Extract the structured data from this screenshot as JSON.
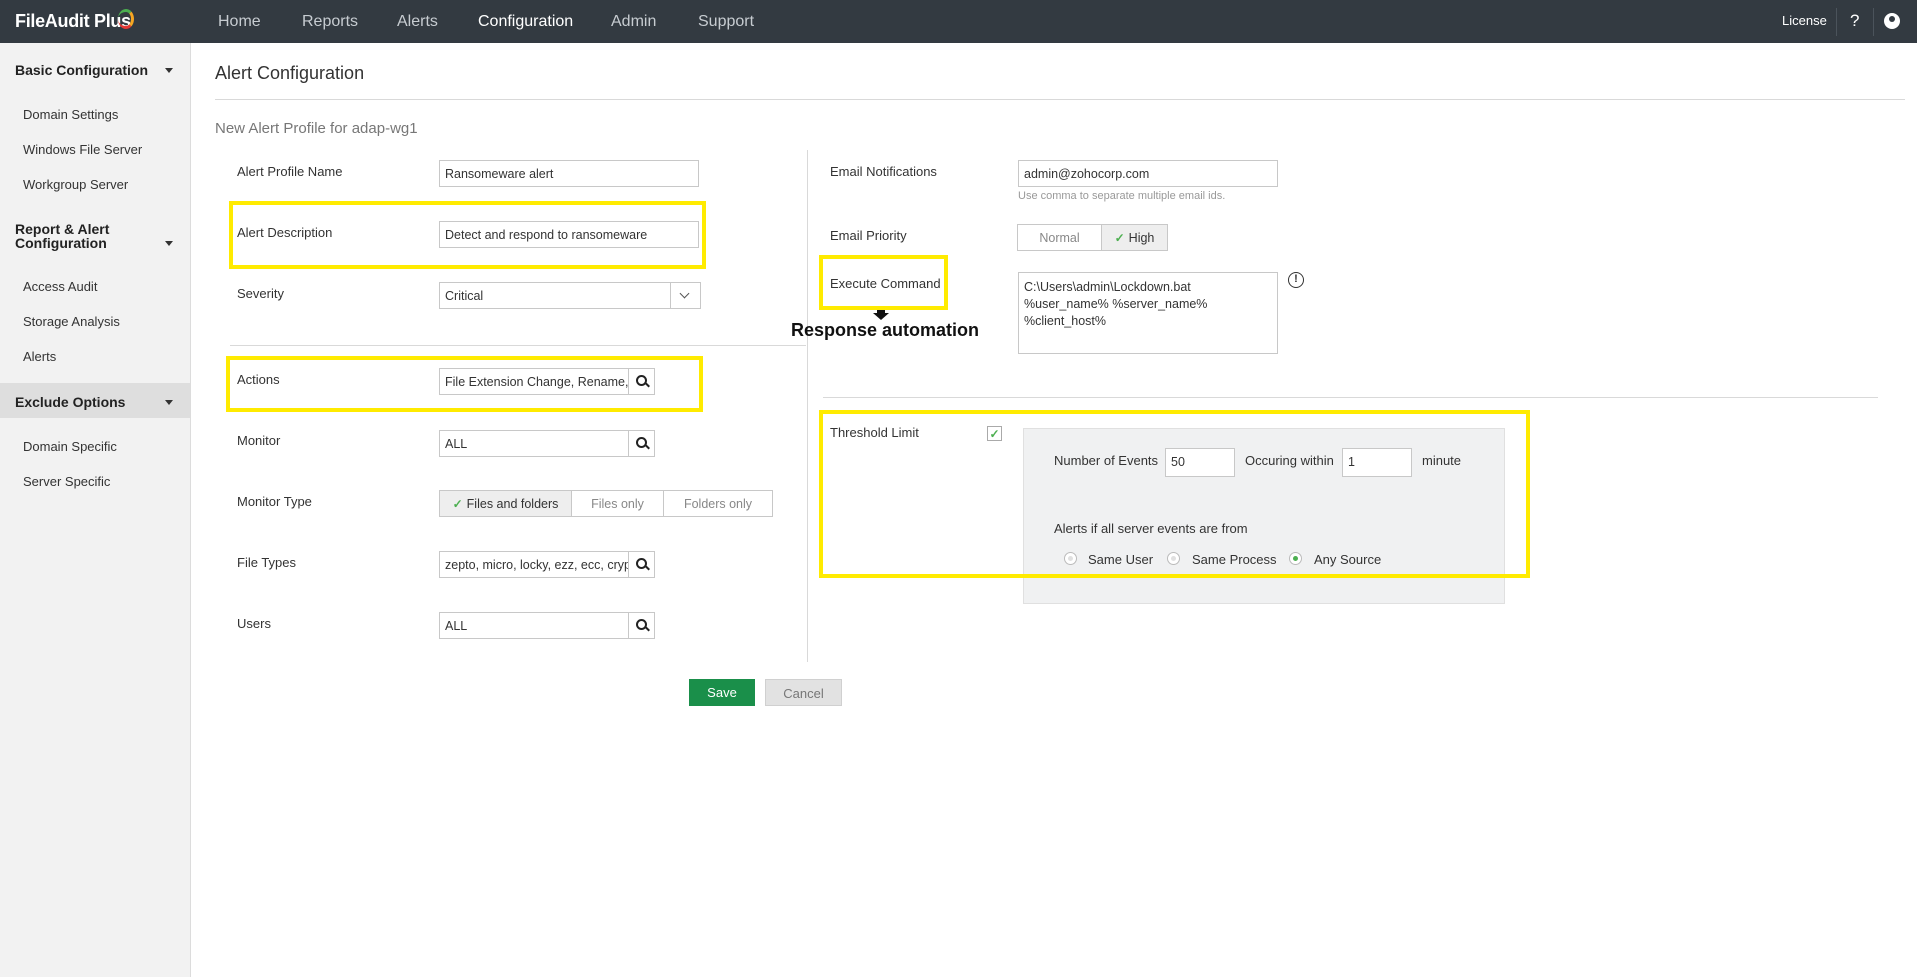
{
  "header": {
    "logo": "FileAudit Plus",
    "nav": [
      "Home",
      "Reports",
      "Alerts",
      "Configuration",
      "Admin",
      "Support"
    ],
    "active_nav": "Configuration",
    "license": "License",
    "help": "?"
  },
  "sidebar": {
    "sections": [
      {
        "title": "Basic Configuration",
        "items": [
          "Domain Settings",
          "Windows File Server",
          "Workgroup Server"
        ]
      },
      {
        "title": "Report & Alert Configuration",
        "items": [
          "Access Audit",
          "Storage Analysis",
          "Alerts"
        ]
      },
      {
        "title": "Exclude Options",
        "items": [
          "Domain Specific",
          "Server Specific"
        ]
      }
    ],
    "active_item": "Alerts"
  },
  "page": {
    "title": "Alert Configuration",
    "subtitle": "New Alert Profile for adap-wg1"
  },
  "form": {
    "profile_name": {
      "label": "Alert Profile Name",
      "value": "Ransomeware alert"
    },
    "description": {
      "label": "Alert Description",
      "value": "Detect and respond to ransomeware"
    },
    "severity": {
      "label": "Severity",
      "value": "Critical"
    },
    "actions": {
      "label": "Actions",
      "value": "File Extension Change, Rename,"
    },
    "monitor": {
      "label": "Monitor",
      "value": "ALL"
    },
    "monitor_type": {
      "label": "Monitor Type",
      "options": [
        "Files and folders",
        "Files only",
        "Folders only"
      ],
      "selected": "Files and folders"
    },
    "file_types": {
      "label": "File Types",
      "value": "zepto, micro, locky, ezz, ecc, cryp"
    },
    "users": {
      "label": "Users",
      "value": "ALL"
    },
    "email": {
      "label": "Email Notifications",
      "value": "admin@zohocorp.com",
      "hint": "Use comma to separate multiple email ids."
    },
    "email_priority": {
      "label": "Email Priority",
      "options": [
        "Normal",
        "High"
      ],
      "selected": "High"
    },
    "execute_command": {
      "label": "Execute Command",
      "value": "C:\\Users\\admin\\Lockdown.bat\n%user_name% %server_name%\n%client_host%"
    },
    "annotation": "Response automation",
    "threshold": {
      "label": "Threshold Limit",
      "checked": true,
      "events_label": "Number of Events",
      "events_value": "50",
      "within_label": "Occuring within",
      "within_value": "1",
      "unit": "minute",
      "source_label": "Alerts if all server events are from",
      "sources": [
        "Same User",
        "Same Process",
        "Any Source"
      ],
      "selected_source": "Any Source"
    }
  },
  "buttons": {
    "save": "Save",
    "cancel": "Cancel"
  },
  "colors": {
    "topbar": "#333a41",
    "accent_green": "#1a8f4a",
    "highlight": "#ffeb00"
  }
}
